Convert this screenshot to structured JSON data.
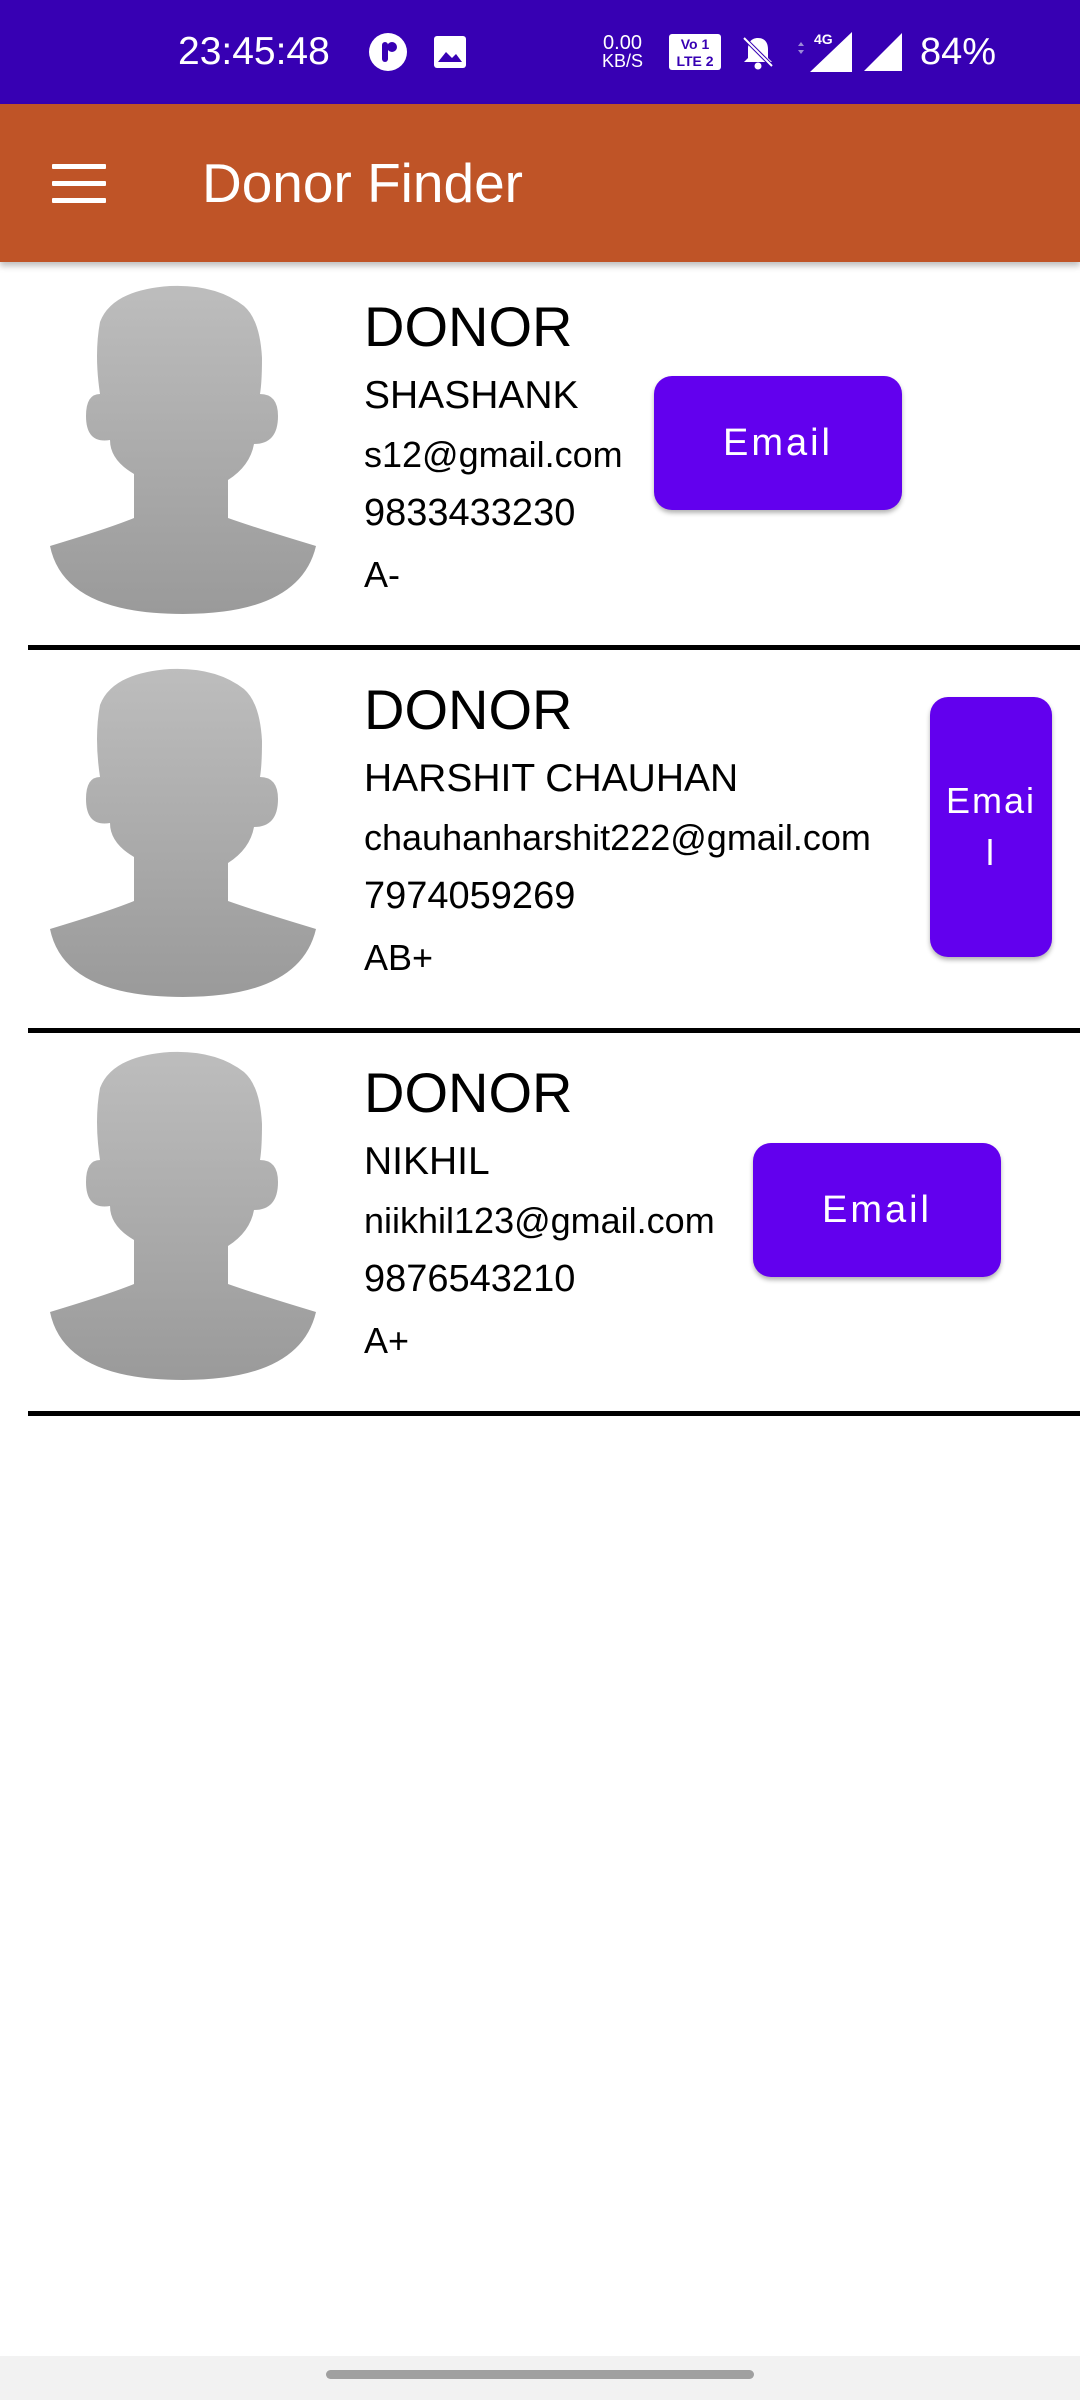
{
  "status_bar": {
    "time": "23:45:48",
    "net_speed_value": "0.00",
    "net_speed_unit": "KB/S",
    "volte_top": "Vo",
    "volte_bottom": "LTE 2",
    "signal_type": "4G",
    "battery": "84%"
  },
  "app_bar": {
    "title": "Donor Finder",
    "menu_icon": "hamburger-menu-icon"
  },
  "donors": [
    {
      "heading": "DONOR",
      "name": "SHASHANK",
      "email": "s12@gmail.com",
      "phone": "9833433230",
      "blood_group": "A-",
      "button_label": "Email"
    },
    {
      "heading": "DONOR",
      "name": "HARSHIT CHAUHAN",
      "email": "chauhanharshit222@gmail.com",
      "phone": "7974059269",
      "blood_group": "AB+",
      "button_label": "Email"
    },
    {
      "heading": "DONOR",
      "name": "NIKHIL",
      "email": "niikhil123@gmail.com",
      "phone": "9876543210",
      "blood_group": "A+",
      "button_label": "Email"
    }
  ],
  "colors": {
    "status_bar": "#3700b3",
    "app_bar": "#bf5427",
    "button": "#6200ee"
  }
}
